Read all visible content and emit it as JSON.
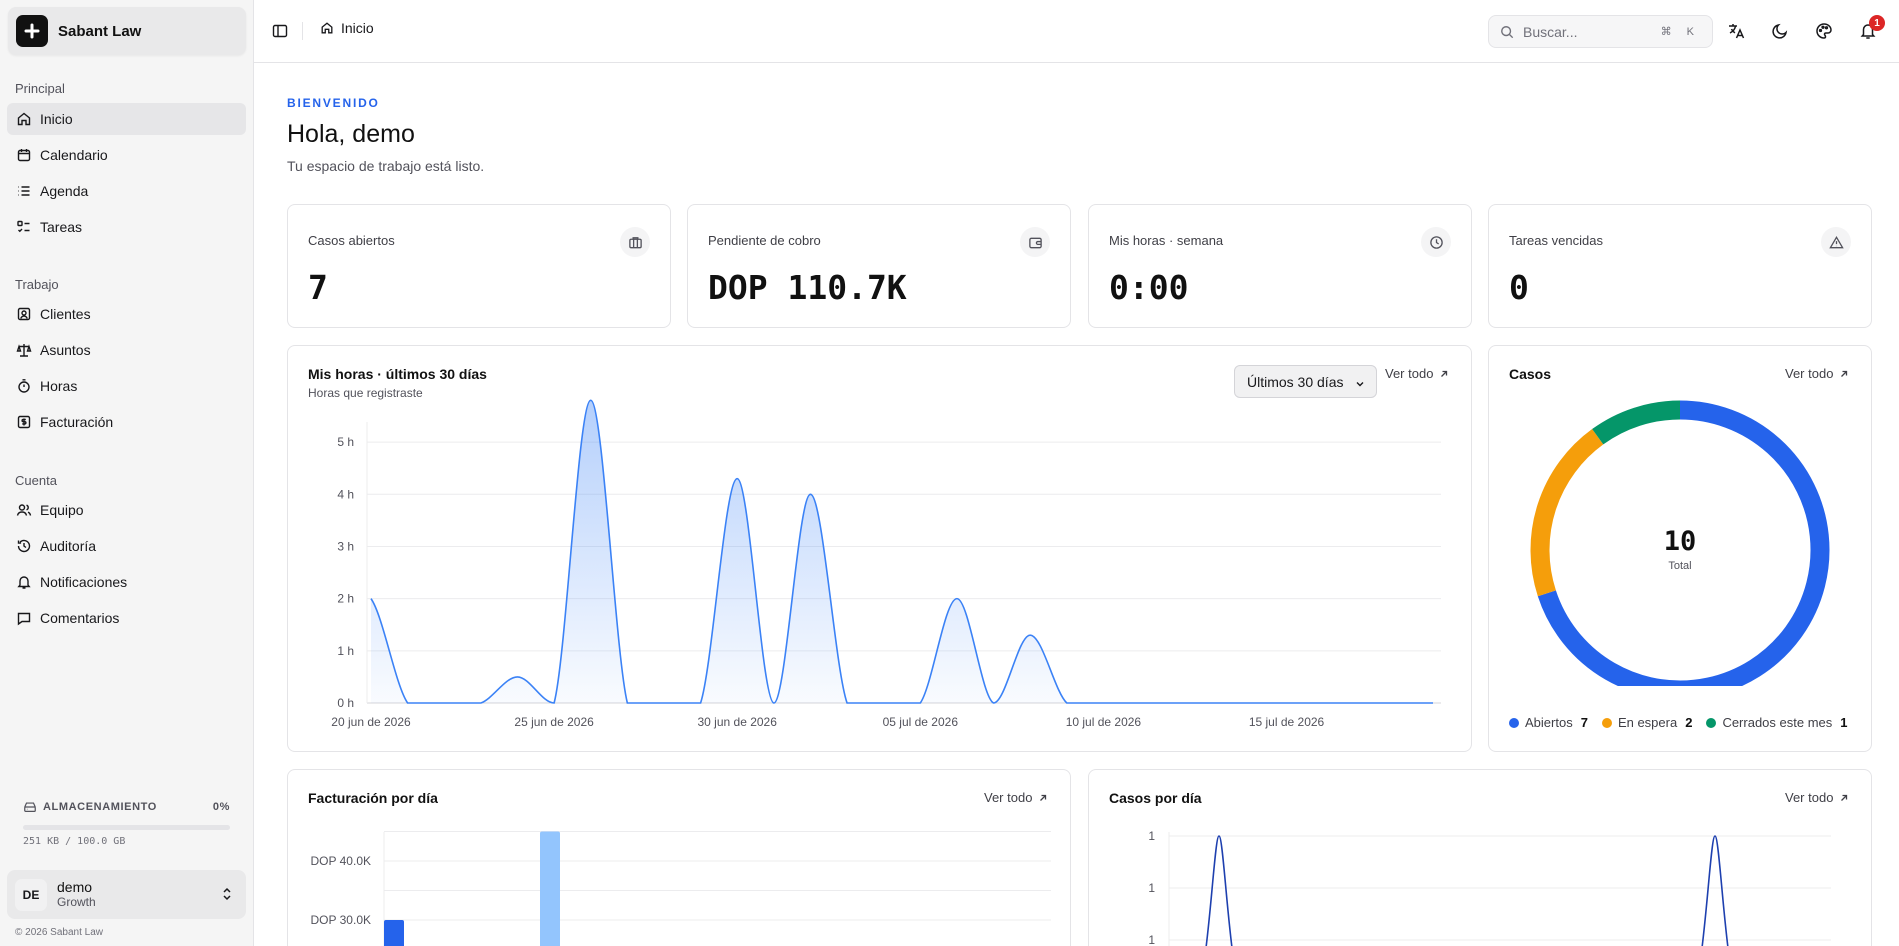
{
  "app": {
    "name": "Sabant Law"
  },
  "sidebar": {
    "sections": [
      {
        "title": "Principal",
        "items": [
          {
            "label": "Inicio",
            "icon": "home-icon",
            "active": true
          },
          {
            "label": "Calendario",
            "icon": "calendar-icon"
          },
          {
            "label": "Agenda",
            "icon": "list-icon"
          },
          {
            "label": "Tareas",
            "icon": "tasks-icon"
          }
        ]
      },
      {
        "title": "Trabajo",
        "items": [
          {
            "label": "Clientes",
            "icon": "contact-icon"
          },
          {
            "label": "Asuntos",
            "icon": "scale-icon"
          },
          {
            "label": "Horas",
            "icon": "timer-icon"
          },
          {
            "label": "Facturación",
            "icon": "invoice-icon"
          }
        ]
      },
      {
        "title": "Cuenta",
        "items": [
          {
            "label": "Equipo",
            "icon": "users-icon"
          },
          {
            "label": "Auditoría",
            "icon": "history-icon"
          },
          {
            "label": "Notificaciones",
            "icon": "bell-icon"
          },
          {
            "label": "Comentarios",
            "icon": "comment-icon"
          }
        ]
      }
    ],
    "storage": {
      "label": "ALMACENAMIENTO",
      "percent": "0%",
      "usage": "251 KB / 100.0 GB",
      "fraction": 0.0
    },
    "user": {
      "initials": "DE",
      "name": "demo",
      "plan": "Growth"
    },
    "copyright": "© 2026 Sabant Law"
  },
  "topbar": {
    "breadcrumb": "Inicio",
    "search_placeholder": "Buscar...",
    "search_shortcut": "⌘ K",
    "notification_count": "1"
  },
  "welcome": {
    "kicker": "BIENVENIDO",
    "title": "Hola, demo",
    "subtitle": "Tu espacio de trabajo está listo."
  },
  "stats": [
    {
      "label": "Casos abiertos",
      "value": "7",
      "icon": "briefcase-icon"
    },
    {
      "label": "Pendiente de cobro",
      "value": "DOP 110.7K",
      "icon": "wallet-icon"
    },
    {
      "label": "Mis horas · semana",
      "value": "0:00",
      "icon": "clock-icon"
    },
    {
      "label": "Tareas vencidas",
      "value": "0",
      "icon": "warning-icon"
    }
  ],
  "hours_card": {
    "title": "Mis horas · últimos 30 días",
    "subtitle": "Horas que registraste",
    "range": "Últimos 30 días",
    "see_all": "Ver todo"
  },
  "cases_card": {
    "title": "Casos",
    "see_all": "Ver todo",
    "total_label": "Total"
  },
  "billing_card": {
    "title": "Facturación por día",
    "see_all": "Ver todo"
  },
  "cases_day_card": {
    "title": "Casos por día",
    "see_all": "Ver todo"
  },
  "chart_data": [
    {
      "type": "area",
      "title": "Mis horas · últimos 30 días",
      "subtitle": "Horas que registraste",
      "x_ticks": [
        "20 jun de 2026",
        "25 jun de 2026",
        "30 jun de 2026",
        "05 jul de 2026",
        "10 jul de 2026",
        "15 jul de 2026"
      ],
      "y_ticks": [
        "0 h",
        "1 h",
        "2 h",
        "3 h",
        "4 h",
        "5 h"
      ],
      "ylim": [
        0,
        5.5
      ],
      "x": [
        "20 jun",
        "21 jun",
        "22 jun",
        "23 jun",
        "24 jun",
        "25 jun",
        "26 jun",
        "27 jun",
        "28 jun",
        "29 jun",
        "30 jun",
        "01 jul",
        "02 jul",
        "03 jul",
        "04 jul",
        "05 jul",
        "06 jul",
        "07 jul",
        "08 jul",
        "09 jul",
        "10 jul",
        "11 jul",
        "12 jul",
        "13 jul",
        "14 jul",
        "15 jul",
        "16 jul",
        "17 jul",
        "18 jul",
        "19 jul"
      ],
      "values": [
        2.0,
        0,
        0,
        0,
        0.5,
        0,
        5.8,
        0,
        0,
        0,
        4.3,
        0,
        4.0,
        0,
        0,
        0,
        2.0,
        0,
        1.3,
        0,
        0,
        0,
        0,
        0,
        0,
        0,
        0,
        0,
        0,
        0
      ],
      "color": "#3b82f6",
      "grid": true
    },
    {
      "type": "pie",
      "title": "Casos",
      "center_value": "10",
      "center_label": "Total",
      "slices": [
        {
          "label": "Abiertos",
          "value": 7,
          "color": "#2563eb"
        },
        {
          "label": "En espera",
          "value": 2,
          "color": "#f59e0b"
        },
        {
          "label": "Cerrados este mes",
          "value": 1,
          "color": "#059669"
        }
      ]
    },
    {
      "type": "bar",
      "title": "Facturación por día",
      "y_ticks": [
        "DOP 30.0K",
        "DOP 40.0K"
      ],
      "values": [
        {
          "label": "bar-1",
          "value": 30000,
          "color": "#2563eb"
        },
        {
          "label": "bar-2",
          "value": 45000,
          "color": "#93c5fd"
        }
      ]
    },
    {
      "type": "line",
      "title": "Casos por día",
      "y_ticks": [
        "1",
        "1",
        "1"
      ]
    }
  ]
}
